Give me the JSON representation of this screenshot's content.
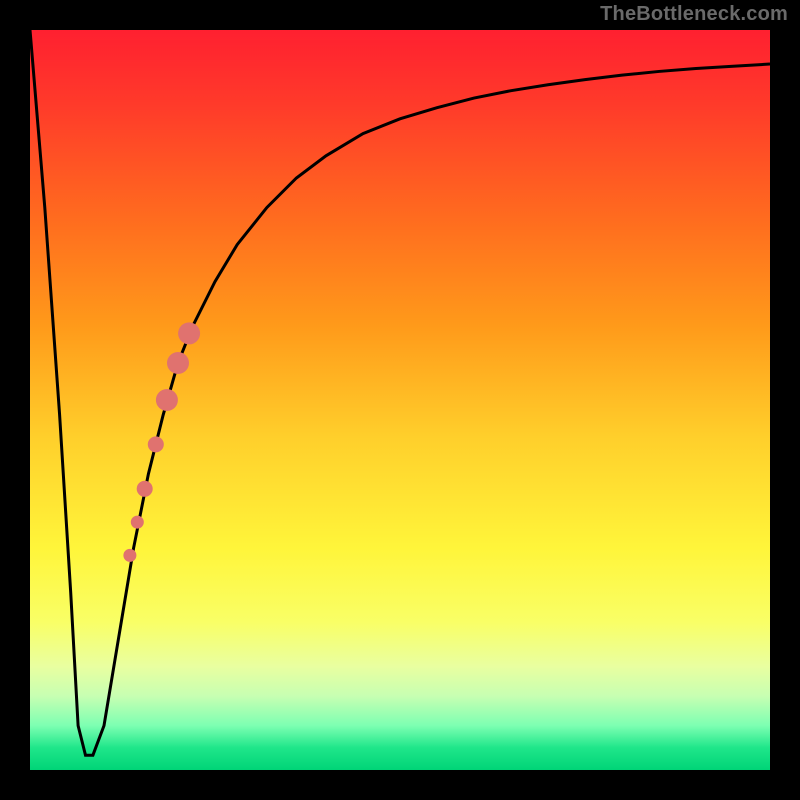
{
  "attribution": "TheBottleneck.com",
  "colors": {
    "frame": "#000000",
    "attribution_text": "#6a6a6a",
    "curve_stroke": "#000000",
    "marker_fill": "#e0726f",
    "marker_stroke": "#c25a56",
    "gradient_stops": [
      {
        "pct": 0,
        "hex": "#ff2030"
      },
      {
        "pct": 10,
        "hex": "#ff3a2a"
      },
      {
        "pct": 25,
        "hex": "#ff6a1f"
      },
      {
        "pct": 40,
        "hex": "#ff9a1a"
      },
      {
        "pct": 55,
        "hex": "#ffcf2b"
      },
      {
        "pct": 70,
        "hex": "#fff53a"
      },
      {
        "pct": 80,
        "hex": "#f9ff66"
      },
      {
        "pct": 86,
        "hex": "#e9ffa0"
      },
      {
        "pct": 90,
        "hex": "#c7ffb2"
      },
      {
        "pct": 94,
        "hex": "#7dffb2"
      },
      {
        "pct": 97,
        "hex": "#1fe68a"
      },
      {
        "pct": 100,
        "hex": "#00d477"
      }
    ]
  },
  "chart_data": {
    "type": "line",
    "title": "",
    "xlabel": "",
    "ylabel": "",
    "xlim": [
      0,
      100
    ],
    "ylim": [
      0,
      100
    ],
    "grid": false,
    "legend": false,
    "series": [
      {
        "name": "bottleneck-curve",
        "x": [
          0,
          2,
          4,
          5.5,
          6.5,
          7.5,
          8.5,
          10,
          12,
          14,
          16,
          18,
          20,
          22,
          25,
          28,
          32,
          36,
          40,
          45,
          50,
          55,
          60,
          65,
          70,
          75,
          80,
          85,
          90,
          95,
          100
        ],
        "y": [
          100,
          76,
          48,
          24,
          6,
          2,
          2,
          6,
          18,
          30,
          40,
          48,
          55,
          60,
          66,
          71,
          76,
          80,
          83,
          86,
          88,
          89.5,
          90.8,
          91.8,
          92.6,
          93.3,
          93.9,
          94.4,
          94.8,
          95.1,
          95.4
        ]
      }
    ],
    "markers": [
      {
        "name": "highlighted-cluster-top",
        "x": 21.5,
        "y": 59
      },
      {
        "name": "highlighted-cluster-mid-a",
        "x": 20.0,
        "y": 55
      },
      {
        "name": "highlighted-cluster-mid-b",
        "x": 18.5,
        "y": 50
      },
      {
        "name": "highlighted-cluster-mid-c",
        "x": 17.0,
        "y": 44
      },
      {
        "name": "highlighted-cluster-low-a",
        "x": 15.5,
        "y": 38
      },
      {
        "name": "highlighted-cluster-low-b",
        "x": 14.5,
        "y": 33.5
      },
      {
        "name": "highlighted-cluster-low-c",
        "x": 13.5,
        "y": 29
      }
    ]
  }
}
